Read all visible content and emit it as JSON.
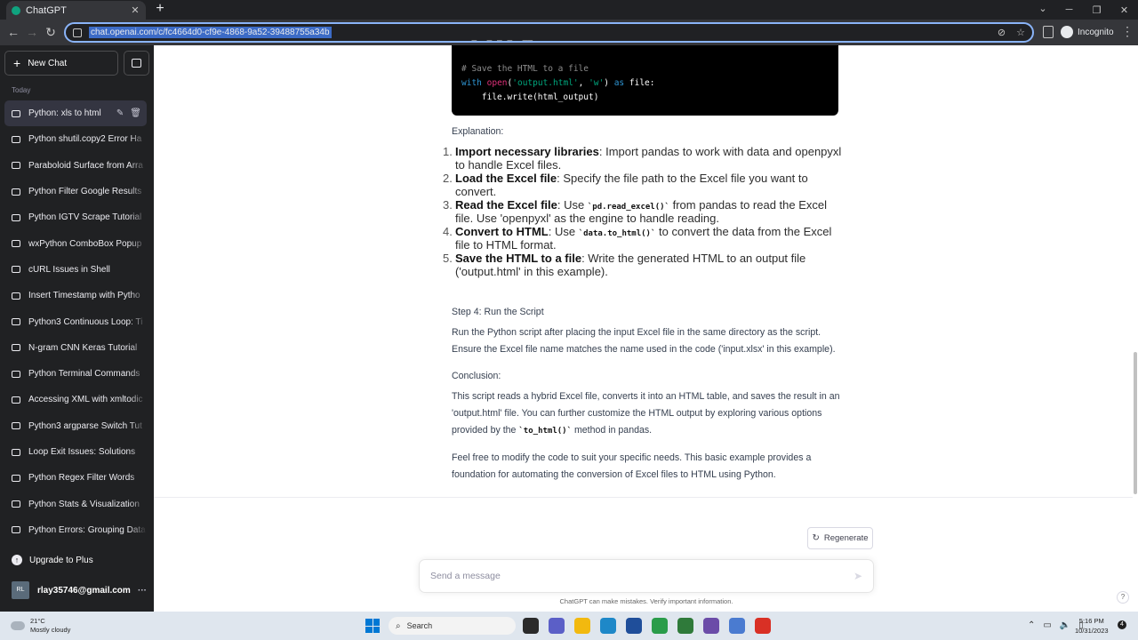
{
  "browser": {
    "tab_title": "ChatGPT",
    "tab_close": "✕",
    "new_tab": "+",
    "url": "chat.openai.com/c/fc4664d0-cf9e-4868-9a52-39488755a34b",
    "incognito_label": "Incognito",
    "window_controls": [
      "⌄",
      "─",
      "❐",
      "✕"
    ]
  },
  "sidebar": {
    "new_chat_label": "New Chat",
    "section_today": "Today",
    "items": [
      {
        "label": "Python: xls to html"
      },
      {
        "label": "Python shutil.copy2 Error Ha"
      },
      {
        "label": "Paraboloid Surface from Arra"
      },
      {
        "label": "Python Filter Google Results"
      },
      {
        "label": "Python IGTV Scrape Tutorial"
      },
      {
        "label": "wxPython ComboBox Popup"
      },
      {
        "label": "cURL Issues in Shell"
      },
      {
        "label": "Insert Timestamp with Pytho"
      },
      {
        "label": "Python3 Continuous Loop: Ti"
      },
      {
        "label": "N-gram CNN Keras Tutorial"
      },
      {
        "label": "Python Terminal Commands"
      },
      {
        "label": "Accessing XML with xmltodic"
      },
      {
        "label": "Python3 argparse Switch Tut"
      },
      {
        "label": "Loop Exit Issues: Solutions"
      },
      {
        "label": "Python Regex Filter Words"
      },
      {
        "label": "Python Stats & Visualization"
      },
      {
        "label": "Python Errors: Grouping Data"
      }
    ],
    "upgrade_label": "Upgrade to Plus",
    "account_initials": "RL",
    "account_email": "rlay35746@gmail.com",
    "account_more": "···"
  },
  "code": {
    "line_comment": "# Save the HTML to a file",
    "kw_with": "with",
    "fn_open": "open",
    "arg_file": "'output.html'",
    "arg_mode": "'w'",
    "kw_as": "as",
    "var_file": "file:",
    "line_write": "    file.write(html_output)"
  },
  "answer": {
    "explanation_heading": "Explanation:",
    "steps": [
      {
        "num": "1.",
        "bold": "Import necessary libraries",
        "text": ": Import pandas to work with data and openpyxl to handle Excel files."
      },
      {
        "num": "2.",
        "bold": "Load the Excel file",
        "text": ": Specify the file path to the Excel file you want to convert."
      },
      {
        "num": "3.",
        "bold": "Read the Excel file",
        "pre": ": Use ",
        "code": "`pd.read_excel()`",
        "text": " from pandas to read the Excel file. Use 'openpyxl' as the engine to handle reading."
      },
      {
        "num": "4.",
        "bold": "Convert to HTML",
        "pre": ": Use ",
        "code": "`data.to_html()`",
        "text": " to convert the data from the Excel file to HTML format."
      },
      {
        "num": "5.",
        "bold": "Save the HTML to a file",
        "text": ": Write the generated HTML to an output file ('output.html' in this example)."
      }
    ],
    "step4_heading": "Step 4: Run the Script",
    "step4_text": "Run the Python script after placing the input Excel file in the same directory as the script. Ensure the Excel file name matches the name used in the code ('input.xlsx' in this example).",
    "conclusion_heading": "Conclusion:",
    "conclusion_pre": "This script reads a hybrid Excel file, converts it into an HTML table, and saves the result in an 'output.html' file. You can further customize the HTML output by exploring various options provided by the ",
    "conclusion_code": "`to_html()`",
    "conclusion_post": " method in pandas.",
    "closing_text": "Feel free to modify the code to suit your specific needs. This basic example provides a foundation for automating the conversion of Excel files to HTML using Python."
  },
  "composer": {
    "regenerate_label": "Regenerate",
    "placeholder": "Send a message",
    "disclaimer": "ChatGPT can make mistakes. Verify important information.",
    "help": "?"
  },
  "taskbar": {
    "weather_temp": "21°C",
    "weather_desc": "Mostly cloudy",
    "search_label": "Search",
    "time": "5:16 PM",
    "date": "10/31/2023",
    "notification_count": "4",
    "app_colors": [
      "#2b2b2b",
      "#5b5fc7",
      "#f2b90f",
      "#1e88c8",
      "#1f4e9a",
      "#2a9c4a",
      "#2f7a3a",
      "#6b4ca8",
      "#4a7bd0",
      "#d93025"
    ]
  },
  "colors": {
    "sidebar_bg": "#202123",
    "accent": "#10a37f",
    "omnibox_focus": "#8ab4f8"
  }
}
